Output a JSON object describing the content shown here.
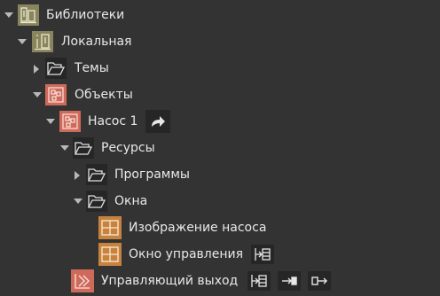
{
  "tree": {
    "libraries": {
      "label": "Библиотеки",
      "icon": "library-icon"
    },
    "local": {
      "label": "Локальная",
      "icon": "local-library-icon"
    },
    "themes": {
      "label": "Темы",
      "icon": "folder-icon"
    },
    "objects": {
      "label": "Объекты",
      "icon": "objects-icon"
    },
    "pump1": {
      "label": "Насос 1",
      "icon": "object-icon",
      "action_icon": "redirect-arrow-icon"
    },
    "resources": {
      "label": "Ресурсы",
      "icon": "folder-icon"
    },
    "programs": {
      "label": "Программы",
      "icon": "folder-icon"
    },
    "windows": {
      "label": "Окна",
      "icon": "folder-icon"
    },
    "pump_image": {
      "label": "Изображение насоса",
      "icon": "window-icon"
    },
    "control_window": {
      "label": "Окно управления",
      "icon": "window-icon",
      "action_icon": "insert-into-icon"
    },
    "control_output": {
      "label": "Управляющий выход",
      "icon": "control-output-icon",
      "action_icons": [
        "insert-into-icon",
        "arrow-into-icon",
        "arrow-out-icon"
      ]
    }
  },
  "colors": {
    "background": "#333333",
    "library_icon_bg": "#88845c",
    "object_icon_bg": "#cf6a5b",
    "window_icon_bg": "#c7823e",
    "folder_icon_bg": "#262626",
    "text": "#e8e8e8"
  }
}
